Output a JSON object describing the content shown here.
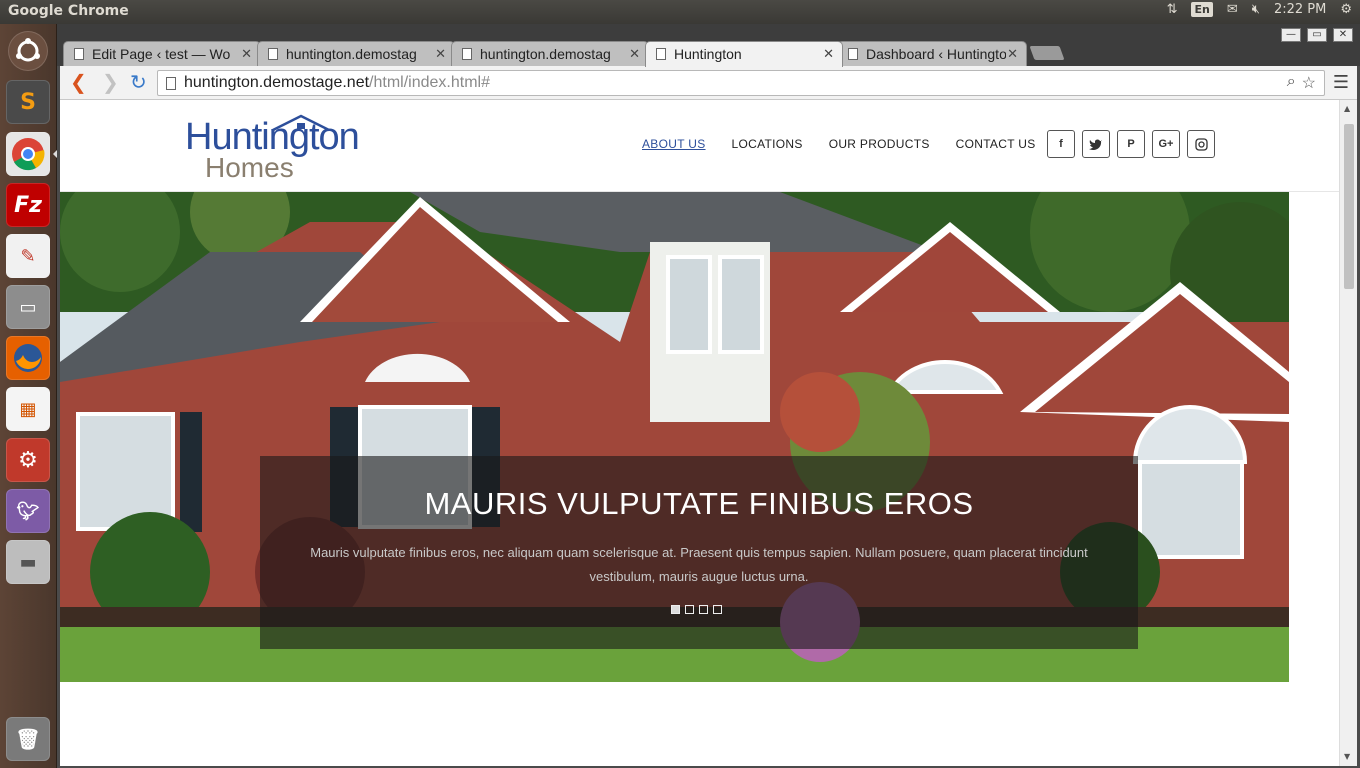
{
  "desktop": {
    "app_title": "Google Chrome",
    "clock": "2:22 PM",
    "keyboard_layout": "En"
  },
  "launcher": {
    "items": [
      "ubuntu-dash",
      "sublime-text",
      "chrome",
      "filezilla",
      "text-editor",
      "files",
      "firefox",
      "impress",
      "system-settings",
      "pidgin",
      "disk"
    ]
  },
  "tabs": [
    {
      "label": "Edit Page ‹ test — Wo",
      "active": false
    },
    {
      "label": "huntington.demostag",
      "active": false
    },
    {
      "label": "huntington.demostag",
      "active": false
    },
    {
      "label": "Huntington",
      "active": true
    },
    {
      "label": "Dashboard ‹ Huntingto",
      "active": false
    }
  ],
  "address": {
    "host": "huntington.demostage.net",
    "path": "/html/index.html#"
  },
  "site": {
    "logo_top": "Huntington",
    "logo_bottom": "Homes",
    "nav": [
      "ABOUT US",
      "LOCATIONS",
      "OUR PRODUCTS",
      "CONTACT US"
    ],
    "social": [
      "f",
      "t",
      "p",
      "G+",
      "ig"
    ],
    "hero": {
      "title": "MAURIS VULPUTATE FINIBUS EROS",
      "text": "Mauris vulputate finibus eros, nec aliquam quam scelerisque at. Praesent quis tempus sapien. Nullam posuere, quam placerat tincidunt vestibulum, mauris augue luctus urna.",
      "slides": 4,
      "active_slide": 1
    }
  },
  "colors": {
    "brand_blue": "#2d4f9b",
    "brand_taupe": "#8a7f6f",
    "launcher": "#5d4436"
  }
}
